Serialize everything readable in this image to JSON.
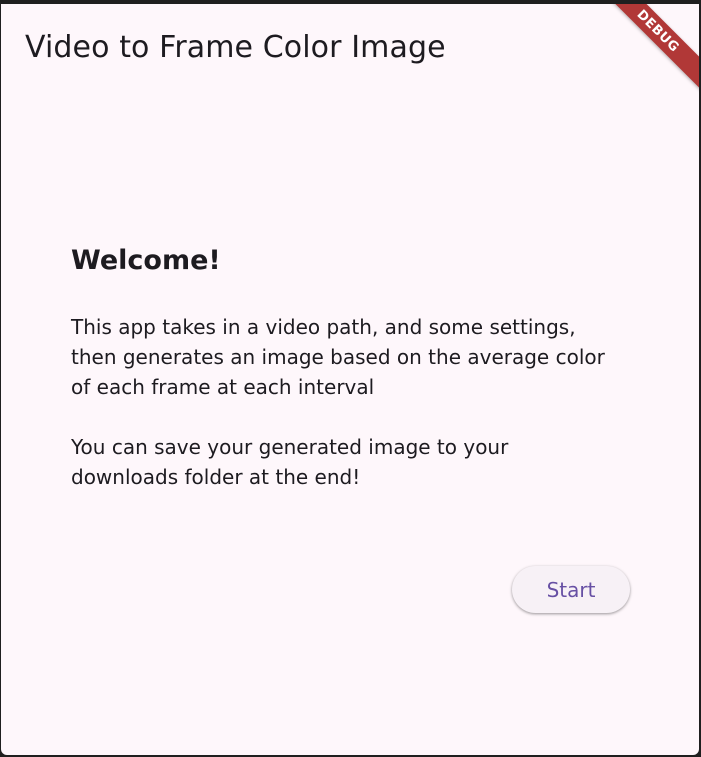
{
  "app": {
    "title": "Video to Frame Color Image",
    "debug_banner": "DEBUG"
  },
  "main": {
    "heading": "Welcome!",
    "paragraph1": "This app takes in a video path, and some settings, then generates an image based on the average color of each frame at each interval",
    "paragraph2": "You can save your generated image to your downloads folder at the end!",
    "start_label": "Start"
  },
  "colors": {
    "background": "#fef7fb",
    "accent": "#6750a4",
    "debug_ribbon": "#b13837"
  }
}
